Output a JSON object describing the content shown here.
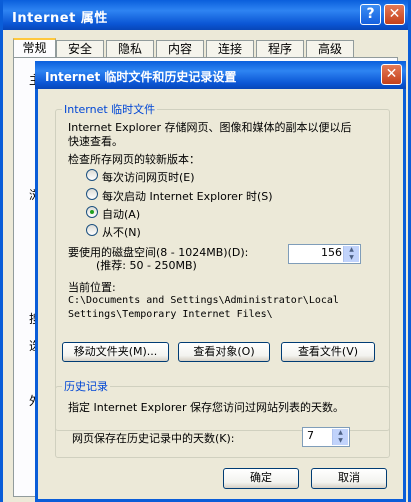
{
  "outer_window": {
    "title": "Internet 属性",
    "help_label": "?",
    "close_label": "✕",
    "tabs": [
      "常规",
      "安全",
      "隐私",
      "内容",
      "连接",
      "程序",
      "高级"
    ],
    "side_fragments": [
      "主",
      "浏",
      "搜",
      "选",
      "外"
    ]
  },
  "dialog": {
    "title": "Internet 临时文件和历史记录设置",
    "close_label": "✕",
    "temp_files": {
      "legend": "Internet 临时文件",
      "description_line1": "Internet Explorer 存储网页、图像和媒体的副本以便以后",
      "description_line2": "快速查看。",
      "check_label": "检查所存网页的较新版本：",
      "options": [
        {
          "label": "每次访问网页时(E)",
          "selected": false
        },
        {
          "label": "每次启动 Internet Explorer 时(S)",
          "selected": false
        },
        {
          "label": "自动(A)",
          "selected": true
        },
        {
          "label": "从不(N)",
          "selected": false
        }
      ],
      "disk_space_label": "要使用的磁盘空间(8 - 1024MB)(D):",
      "recommend_label": "(推荐: 50 - 250MB)",
      "disk_space_value": "156",
      "location_label": "当前位置:",
      "location_path_line1": "C:\\Documents and Settings\\Administrator\\Local",
      "location_path_line2": "Settings\\Temporary Internet Files\\",
      "buttons": {
        "move_folder": "移动文件夹(M)...",
        "view_objects": "查看对象(O)",
        "view_files": "查看文件(V)"
      }
    },
    "history": {
      "legend": "历史记录",
      "description": "指定 Internet Explorer 保存您访问过网站列表的天数。",
      "days_label": "网页保存在历史记录中的天数(K):",
      "days_value": "7"
    },
    "ok_label": "确定",
    "cancel_label": "取消"
  }
}
